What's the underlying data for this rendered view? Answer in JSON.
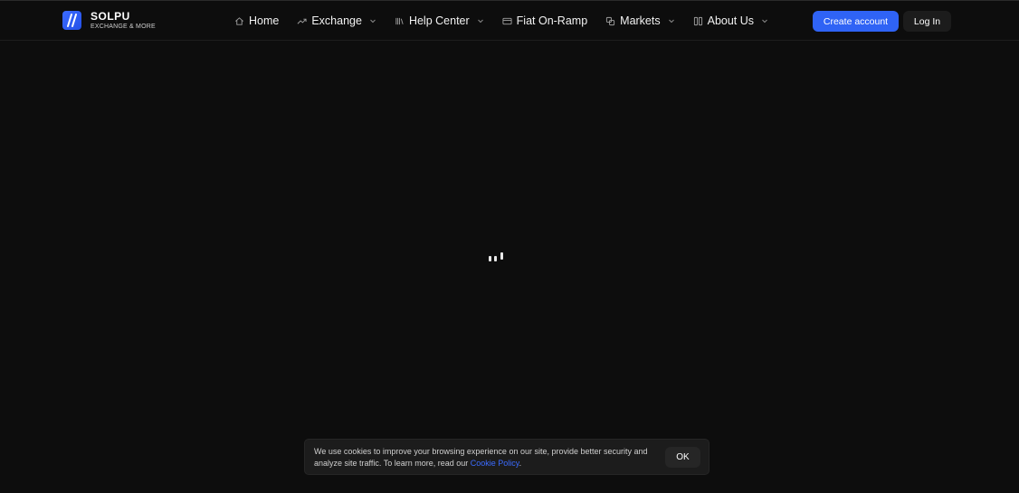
{
  "brand": {
    "name": "SOLPU",
    "tagline": "EXCHANGE & MORE",
    "accent_color": "#2f63f5"
  },
  "nav": {
    "items": [
      {
        "label": "Home",
        "icon": "home-icon",
        "has_dropdown": false
      },
      {
        "label": "Exchange",
        "icon": "trending-up-icon",
        "has_dropdown": true
      },
      {
        "label": "Help Center",
        "icon": "book-icon",
        "has_dropdown": true
      },
      {
        "label": "Fiat On-Ramp",
        "icon": "card-transfer-icon",
        "has_dropdown": false
      },
      {
        "label": "Markets",
        "icon": "coins-icon",
        "has_dropdown": true
      },
      {
        "label": "About Us",
        "icon": "grid-icon",
        "has_dropdown": true
      }
    ]
  },
  "auth": {
    "create_label": "Create account",
    "login_label": "Log In"
  },
  "loader": {
    "icon": "loading-bars-icon"
  },
  "cookie": {
    "text": "We use cookies to improve your browsing experience on our site, provide better security and analyze site traffic. To learn more, read our ",
    "link_label": "Cookie Policy",
    "suffix": ".",
    "ok_label": "OK"
  }
}
